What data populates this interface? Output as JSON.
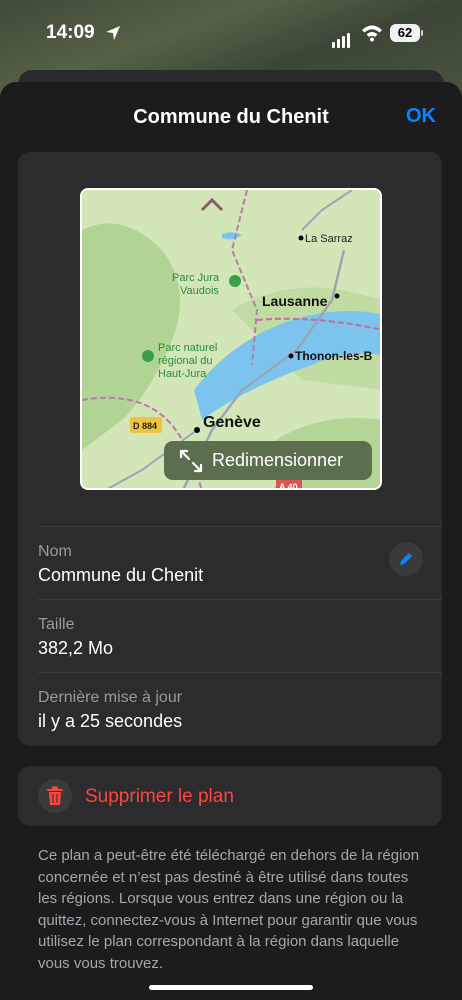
{
  "status_bar": {
    "time": "14:09",
    "battery": "62"
  },
  "sheet": {
    "title": "Commune du Chenit",
    "ok_label": "OK"
  },
  "map": {
    "labels": {
      "la_sarraz": "La Sarraz",
      "parc_jura_vaudois_1": "Parc Jura",
      "parc_jura_vaudois_2": "Vaudois",
      "lausanne": "Lausanne",
      "parc_naturel_1": "Parc naturel",
      "parc_naturel_2": "régional du",
      "parc_naturel_3": "Haut-Jura",
      "thonon": "Thonon-les-B",
      "geneve": "Genève",
      "road_d884": "D 884",
      "road_a40": "A 40"
    },
    "resize_label": "Redimensionner"
  },
  "details": {
    "name_label": "Nom",
    "name_value": "Commune du Chenit",
    "size_label": "Taille",
    "size_value": "382,2 Mo",
    "updated_label": "Dernière mise à jour",
    "updated_value": "il y a 25 secondes"
  },
  "delete_label": "Supprimer le plan",
  "info": "Ce plan a peut-être été téléchargé en dehors de la région concernée et n’est pas destiné à être utilisé dans toutes les régions. Lorsque vous entrez dans une région ou la quittez, connectez-vous à Internet pour garantir que vous utilisez le plan correspondant à la région dans laquelle vous vous trouvez.",
  "colors": {
    "accent": "#0a84ff",
    "destructive": "#ff453a"
  }
}
